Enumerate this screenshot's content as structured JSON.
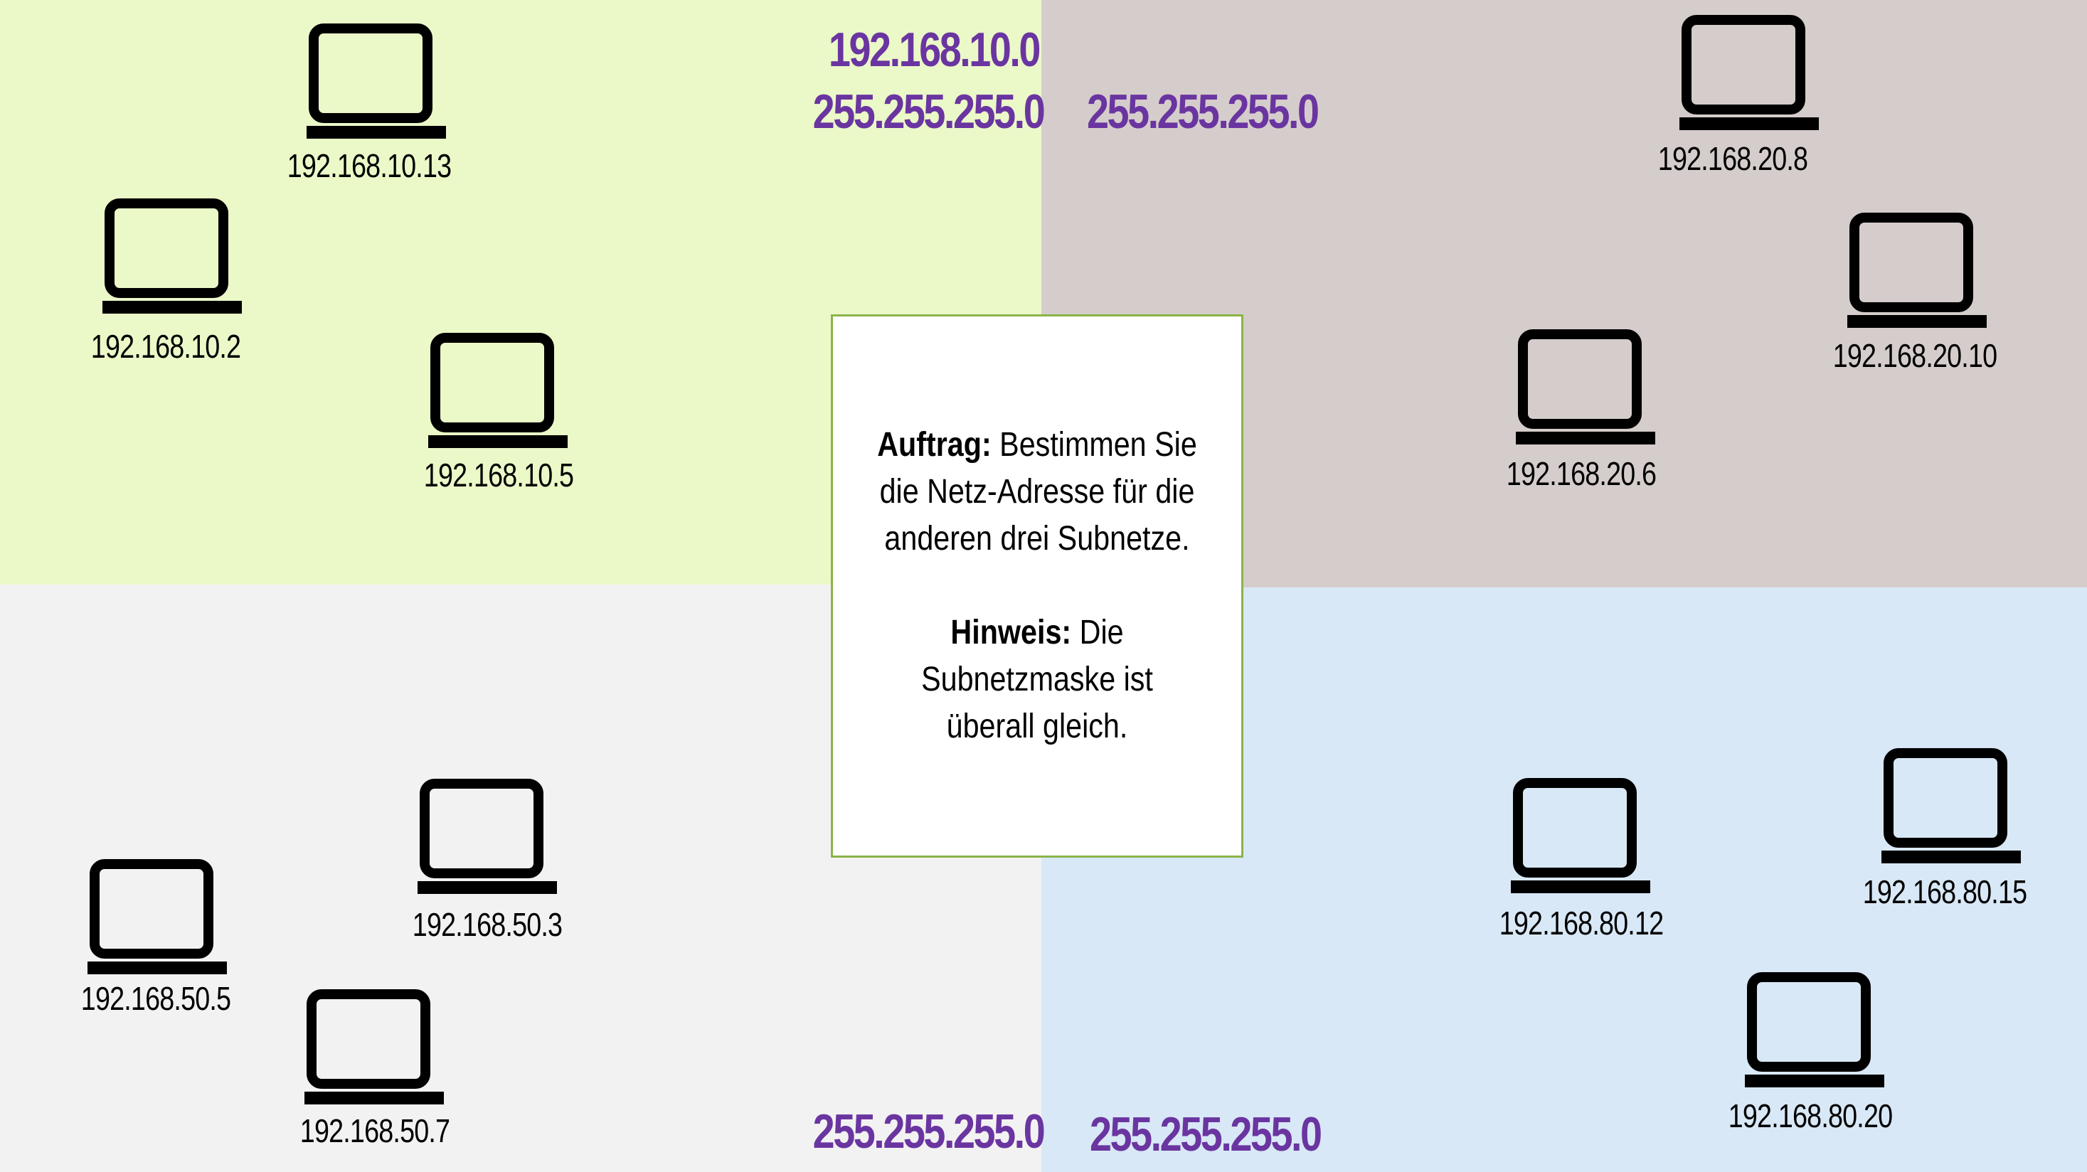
{
  "colors": {
    "top_left": "#ebf8c8",
    "top_right": "#d5cdcb",
    "bottom_left": "#f2f2f2",
    "bottom_right": "#d8e8f6",
    "address_purple": "#6a35a0",
    "box_border": "#8bb448"
  },
  "subnets": {
    "top_left": {
      "network": "192.168.10.0",
      "mask": "255.255.255.0",
      "hosts": [
        "192.168.10.13",
        "192.168.10.2",
        "192.168.10.5"
      ]
    },
    "top_right": {
      "mask": "255.255.255.0",
      "hosts": [
        "192.168.20.8",
        "192.168.20.10",
        "192.168.20.6"
      ]
    },
    "bottom_left": {
      "mask": "255.255.255.0",
      "hosts": [
        "192.168.50.3",
        "192.168.50.5",
        "192.168.50.7"
      ]
    },
    "bottom_right": {
      "mask": "255.255.255.0",
      "hosts": [
        "192.168.80.15",
        "192.168.80.12",
        "192.168.80.20"
      ]
    }
  },
  "task_box": {
    "task_label": "Auftrag:",
    "task_text": " Bestimmen Sie die Netz-Adresse für die anderen drei Subnetze.",
    "hint_label": "Hinweis:",
    "hint_text": " Die Subnetzmaske ist überall gleich."
  },
  "icons": {
    "host": "laptop-icon"
  }
}
